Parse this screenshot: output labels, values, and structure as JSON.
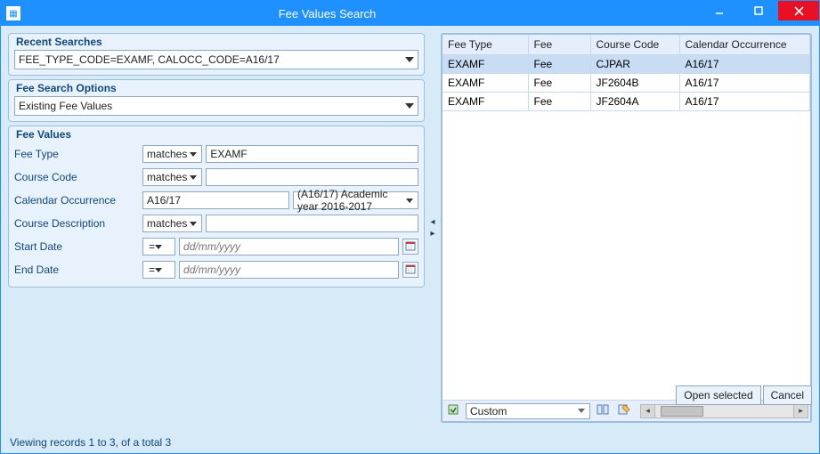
{
  "window": {
    "title": "Fee Values Search"
  },
  "recent": {
    "heading": "Recent Searches",
    "selected": "FEE_TYPE_CODE=EXAMF, CALOCC_CODE=A16/17"
  },
  "options": {
    "heading": "Fee Search Options",
    "selected": "Existing Fee Values"
  },
  "feeValues": {
    "heading": "Fee Values",
    "labels": {
      "feeType": "Fee Type",
      "courseCode": "Course Code",
      "calOcc": "Calendar Occurrence",
      "courseDesc": "Course Description",
      "startDate": "Start Date",
      "endDate": "End Date"
    },
    "operators": {
      "matches": "matches",
      "eq": "="
    },
    "feeType": "EXAMF",
    "courseCode": "",
    "calOccCode": "A16/17",
    "calOccDesc": "(A16/17) Academic year 2016-2017",
    "courseDesc": "",
    "startDate": "",
    "endDate": "",
    "datePlaceholder": "dd/mm/yyyy"
  },
  "table": {
    "columns": [
      "Fee Type",
      "Fee",
      "Course Code",
      "Calendar Occurrence"
    ],
    "rows": [
      {
        "feeType": "EXAMF",
        "fee": "Fee",
        "courseCode": "CJPAR",
        "calOcc": "A16/17",
        "selected": true
      },
      {
        "feeType": "EXAMF",
        "fee": "Fee",
        "courseCode": "JF2604B",
        "calOcc": "A16/17",
        "selected": false
      },
      {
        "feeType": "EXAMF",
        "fee": "Fee",
        "courseCode": "JF2604A",
        "calOcc": "A16/17",
        "selected": false
      }
    ],
    "viewMode": "Custom"
  },
  "buttons": {
    "open": "Open selected",
    "cancel": "Cancel"
  },
  "status": "Viewing records 1 to 3, of a total 3"
}
